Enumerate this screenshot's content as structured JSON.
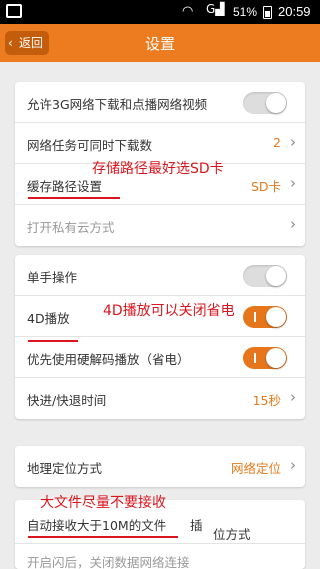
{
  "status_bar": {
    "battery": "51%",
    "time": "20:59",
    "signal_label": "G"
  },
  "nav": {
    "back_label": "返回",
    "title": "设置"
  },
  "section1": [
    {
      "label": "允许3G网络下载和点播网络视频",
      "control": "toggle",
      "state": "off"
    },
    {
      "label": "网络任务可同时下载数",
      "value": "2"
    },
    {
      "label": "缓存路径设置",
      "value": "SD卡"
    },
    {
      "label": "打开私有云方式",
      "disabled": true
    }
  ],
  "section2": [
    {
      "label": "单手操作",
      "control": "toggle",
      "state": "off"
    },
    {
      "label": "4D播放",
      "control": "toggle",
      "state": "on"
    },
    {
      "label": "优先使用硬解码播放（省电）",
      "control": "toggle",
      "state": "on"
    },
    {
      "label": "快进/快退时间",
      "value": "15秒"
    }
  ],
  "section3": [
    {
      "label": "地理定位方式",
      "value": "网络定位"
    },
    {
      "label": "自动接收大于10M的文件",
      "suffix": "位方式"
    }
  ],
  "partial_texts": {
    "row3b_tail": "插",
    "bottom_cut": "开启闪后，关闭数据网络连接"
  },
  "annotations": {
    "sd_card": "存储路径最好选SD卡",
    "four_d": "4D播放可以关闭省电",
    "big_file": "大文件尽量不要接收"
  },
  "colors": {
    "accent": "#ec7c1f",
    "annotation": "#d9161e"
  }
}
